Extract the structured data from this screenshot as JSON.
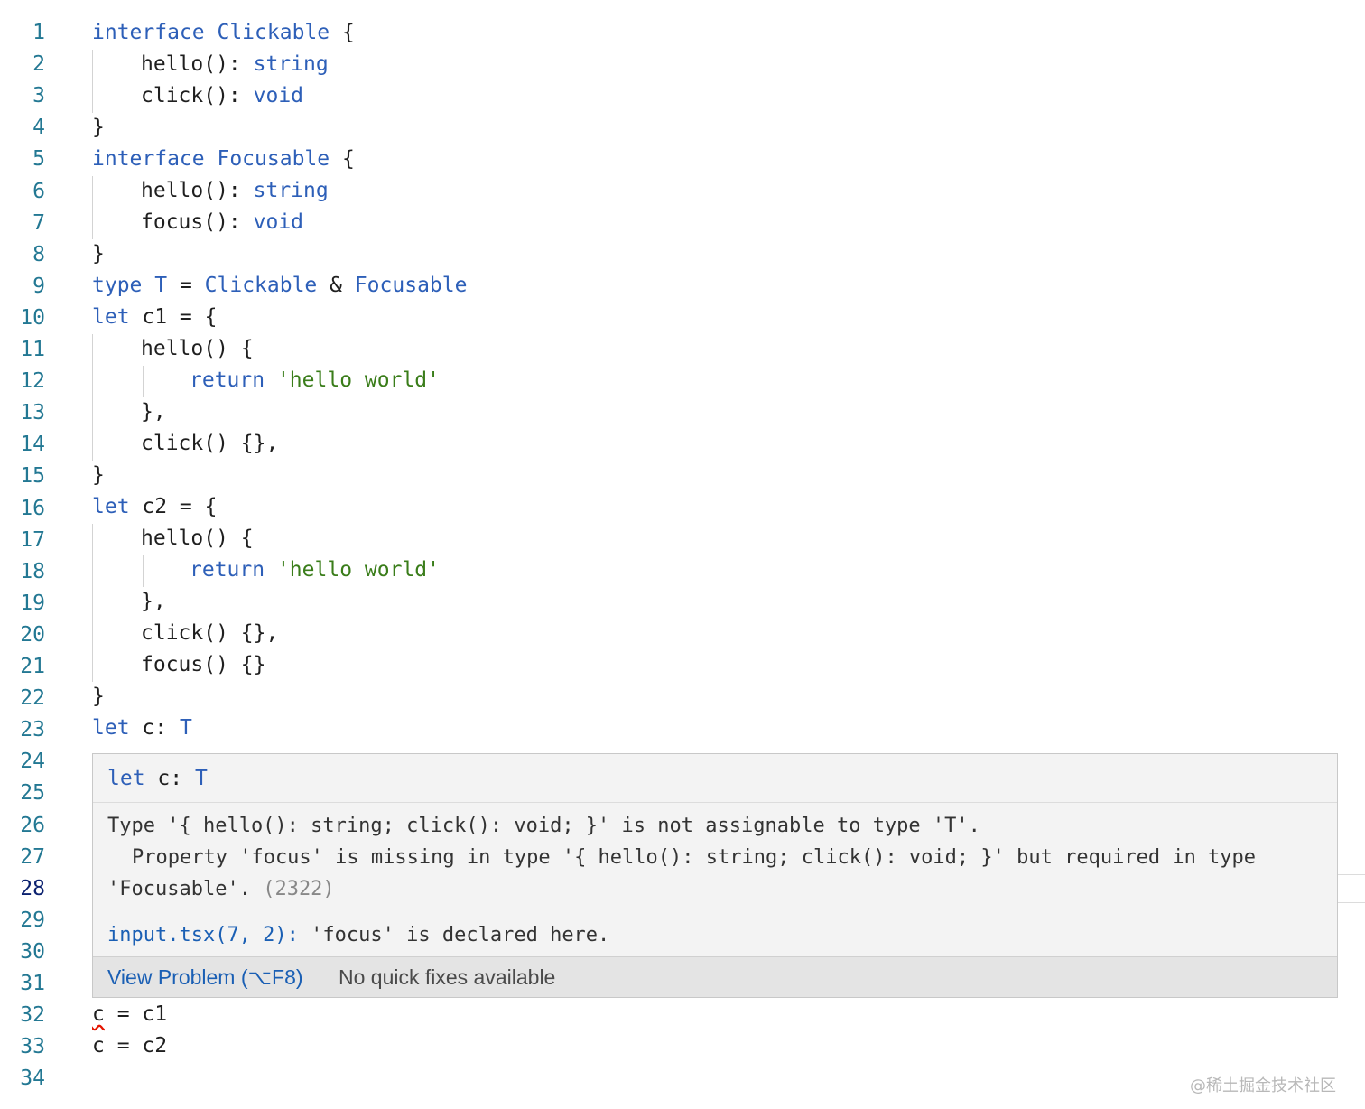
{
  "editor": {
    "line_numbers": [
      "1",
      "2",
      "3",
      "4",
      "5",
      "6",
      "7",
      "8",
      "9",
      "10",
      "11",
      "12",
      "13",
      "14",
      "15",
      "16",
      "17",
      "18",
      "19",
      "20",
      "21",
      "22",
      "23",
      "24",
      "25",
      "26",
      "27",
      "28",
      "29",
      "30",
      "31",
      "32",
      "33",
      "34"
    ],
    "lines": {
      "l1": {
        "kw": "interface",
        "name": "Clickable",
        "rest": " {"
      },
      "l2": {
        "text": "hello(): ",
        "type": "string"
      },
      "l3": {
        "text": "click(): ",
        "type": "void"
      },
      "l4": {
        "text": "}"
      },
      "l5": {
        "kw": "interface",
        "name": "Focusable",
        "rest": " {"
      },
      "l6": {
        "text": "hello(): ",
        "type": "string"
      },
      "l7": {
        "text": "focus(): ",
        "type": "void"
      },
      "l8": {
        "text": "}"
      },
      "l9": {
        "kw": "type",
        "name": "T",
        "eq": " = ",
        "a": "Clickable",
        "amp": " & ",
        "b": "Focusable"
      },
      "l10": {
        "kw": "let",
        "rest": " c1 = {"
      },
      "l11": {
        "text": "hello() {"
      },
      "l12": {
        "kw": "return",
        "str": "'hello world'"
      },
      "l13": {
        "text": "},"
      },
      "l14": {
        "text": "click() {},"
      },
      "l15": {
        "text": "}"
      },
      "l16": {
        "kw": "let",
        "rest": " c2 = {"
      },
      "l17": {
        "text": "hello() {"
      },
      "l18": {
        "kw": "return",
        "str": "'hello world'"
      },
      "l19": {
        "text": "},"
      },
      "l20": {
        "text": "click() {},"
      },
      "l21": {
        "text": "focus() {}"
      },
      "l22": {
        "text": "}"
      },
      "l23": {
        "kw": "let",
        "rest": " c: ",
        "type": "T"
      },
      "l32": {
        "err": "c",
        "rest": " = c1"
      },
      "l33": {
        "text": "c = c2"
      }
    }
  },
  "hover": {
    "signature": {
      "kw": "let",
      "rest": " c: ",
      "type": "T"
    },
    "message_line1": "Type '{ hello(): string; click(): void; }' is not assignable to type 'T'.",
    "message_line2": "Property 'focus' is missing in type '{ hello(): string; click(): void; }' but required in type",
    "message_line3": "'Focusable'.",
    "error_code": "(2322)",
    "related_link": "input.tsx(7, 2):",
    "related_text": " 'focus' is declared here.",
    "actions": {
      "view_problem": "View Problem (⌥F8)",
      "no_quick_fixes": "No quick fixes available"
    }
  },
  "watermark": "@稀土掘金技术社区",
  "colors": {
    "keyword": "#2d5fb8",
    "string": "#3a7d1a",
    "line_number": "#237893",
    "active_line_number": "#0b216f",
    "error_squiggle": "#e51400",
    "hover_background": "#f3f3f3"
  }
}
